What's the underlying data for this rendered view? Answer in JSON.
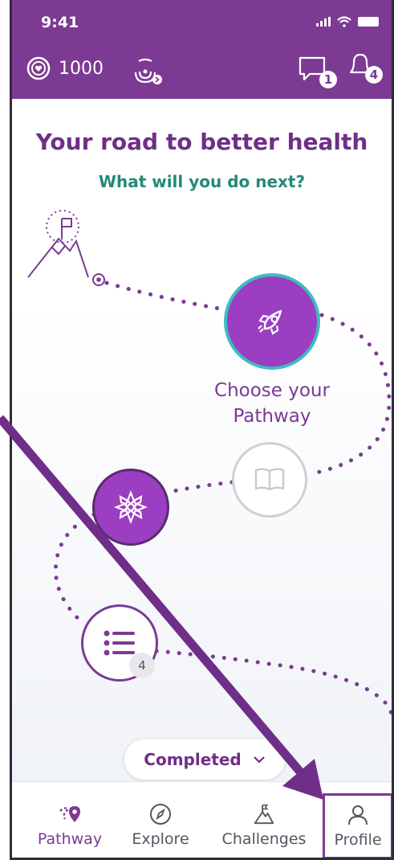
{
  "status_bar": {
    "time": "9:41"
  },
  "header": {
    "points": "1000",
    "messages_count": "1",
    "notifications_count": "4"
  },
  "main": {
    "title": "Your road to better health",
    "subtitle": "What will you do next?",
    "current_node_label_line1": "Choose your",
    "current_node_label_line2": "Pathway",
    "list_node_count": "4",
    "completed_label": "Completed"
  },
  "tabs": [
    {
      "label": "Pathway",
      "icon": "pathway-icon",
      "active": true
    },
    {
      "label": "Explore",
      "icon": "compass-icon",
      "active": false
    },
    {
      "label": "Challenges",
      "icon": "mountain-icon",
      "active": false
    },
    {
      "label": "Profile",
      "icon": "person-icon",
      "active": false
    }
  ],
  "colors": {
    "brand_purple": "#7c3a93",
    "node_purple": "#9b3ec2",
    "teal": "#25897a",
    "highlight": "#7c3a93"
  }
}
